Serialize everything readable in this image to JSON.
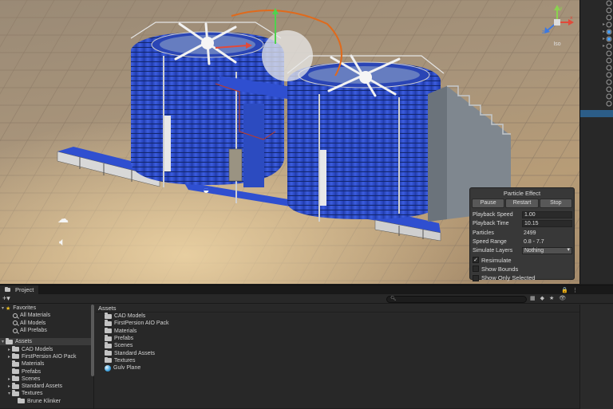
{
  "colors": {
    "accent_blue": "#2c5d87",
    "conveyor_blue": "#2f4fd0",
    "floor": "#a8947a",
    "panel_bg": "#383838"
  },
  "scene": {
    "gizmo_label": "Iso",
    "icons": [
      "light-bulb-icon",
      "audio-source-icon",
      "cloud-icon",
      "sphere-icon"
    ]
  },
  "particle_effect": {
    "title": "Particle Effect",
    "buttons": {
      "pause": "Pause",
      "restart": "Restart",
      "stop": "Stop"
    },
    "playback_speed": {
      "label": "Playback Speed",
      "value": "1.00"
    },
    "playback_time": {
      "label": "Playback Time",
      "value": "10.15"
    },
    "particles": {
      "label": "Particles",
      "value": "2499"
    },
    "speed_range": {
      "label": "Speed Range",
      "value": "0.8 - 7.7"
    },
    "simulate_layers": {
      "label": "Simulate Layers",
      "value": "Nothing"
    },
    "resimulate": {
      "label": "Resimulate",
      "checked": true
    },
    "show_bounds": {
      "label": "Show Bounds",
      "checked": false
    },
    "show_only_selected": {
      "label": "Show Only Selected",
      "checked": false
    }
  },
  "project": {
    "tab_label": "Project",
    "tab_icons": {
      "lock": "🔒",
      "menu": "⋮"
    },
    "search_placeholder": "",
    "favorites": {
      "label": "Favorites",
      "items": [
        "All Materials",
        "All Models",
        "All Prefabs"
      ]
    },
    "assets_root": "Assets",
    "tree": [
      {
        "label": "CAD Models",
        "indent": 1,
        "arrow": "▸"
      },
      {
        "label": "FirstPersion AIO Pack",
        "indent": 1,
        "arrow": "▸"
      },
      {
        "label": "Materials",
        "indent": 1,
        "arrow": ""
      },
      {
        "label": "Prefabs",
        "indent": 1,
        "arrow": ""
      },
      {
        "label": "Scenes",
        "indent": 1,
        "arrow": "▸"
      },
      {
        "label": "Standard Assets",
        "indent": 1,
        "arrow": "▸"
      },
      {
        "label": "Textures",
        "indent": 1,
        "arrow": "▾"
      },
      {
        "label": "Brune Klinker",
        "indent": 2,
        "arrow": ""
      }
    ],
    "assets_header": "Assets",
    "assets": [
      {
        "label": "CAD Models",
        "type": "folder"
      },
      {
        "label": "FirstPersion AIO Pack",
        "type": "folder"
      },
      {
        "label": "Materials",
        "type": "folder"
      },
      {
        "label": "Prefabs",
        "type": "folder"
      },
      {
        "label": "Scenes",
        "type": "folder"
      },
      {
        "label": "Standard Assets",
        "type": "folder"
      },
      {
        "label": "Textures",
        "type": "folder"
      },
      {
        "label": "Gulv Plane",
        "type": "material"
      }
    ]
  }
}
